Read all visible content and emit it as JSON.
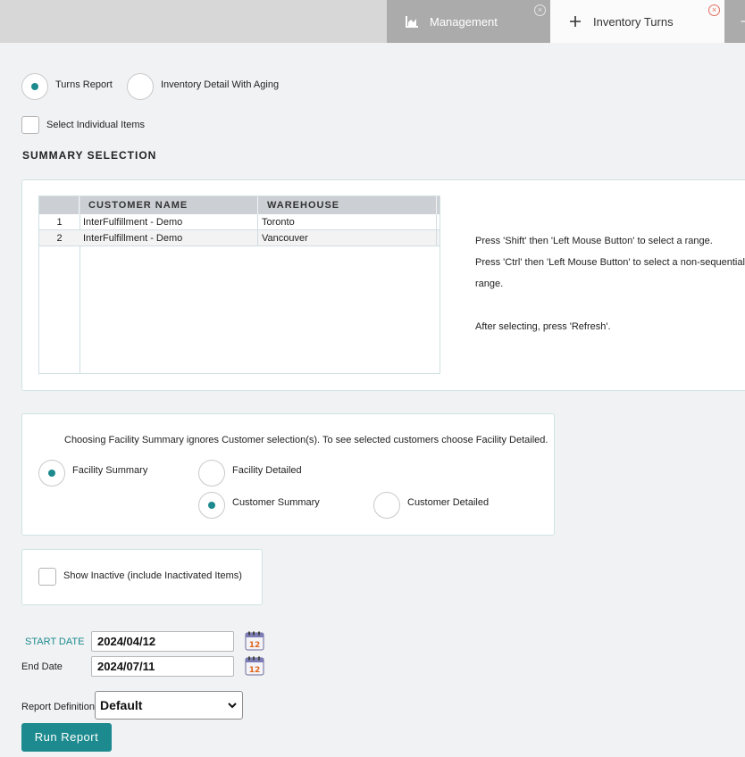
{
  "tabs": [
    {
      "label": "Management",
      "icon": "chart-icon"
    },
    {
      "label": "Inventory Turns",
      "icon": "plus-icon"
    }
  ],
  "report_type": {
    "options": [
      "Turns Report",
      "Inventory Detail With Aging"
    ],
    "selected": "Turns Report"
  },
  "select_individual_items": {
    "label": "Select Individual Items",
    "checked": false
  },
  "summary_section": {
    "title": "SUMMARY SELECTION"
  },
  "grid": {
    "columns": [
      "CUSTOMER NAME",
      "WAREHOUSE"
    ],
    "rows": [
      {
        "num": "1",
        "customer": "InterFulfillment - Demo",
        "warehouse": "Toronto"
      },
      {
        "num": "2",
        "customer": "InterFulfillment - Demo",
        "warehouse": "Vancouver"
      }
    ]
  },
  "hints": {
    "line1": "Press 'Shift' then 'Left Mouse Button' to select a range.",
    "line2": "Press 'Ctrl' then 'Left Mouse Button' to select a non-sequential",
    "line3": "range.",
    "line4": "After selecting, press 'Refresh'."
  },
  "facility": {
    "note": "Choosing Facility Summary ignores Customer selection(s). To see selected customers choose Facility Detailed.",
    "facility_summary": "Facility Summary",
    "facility_detailed": "Facility Detailed",
    "customer_summary": "Customer Summary",
    "customer_detailed": "Customer Detailed",
    "selected_facility": "Facility Summary",
    "selected_customer": "Customer Summary"
  },
  "show_inactive": {
    "label": "Show Inactive (include Inactivated Items)",
    "checked": false
  },
  "dates": {
    "start_label": "START DATE",
    "start_value": "2024/04/12",
    "end_label": "End Date",
    "end_value": "2024/07/11",
    "calendar_day": "12"
  },
  "report_definition": {
    "label": "Report Definition",
    "value": "Default"
  },
  "run_button": "Run Report",
  "colors": {
    "accent": "#1c8a8e",
    "close_active": "#e16d5c"
  }
}
